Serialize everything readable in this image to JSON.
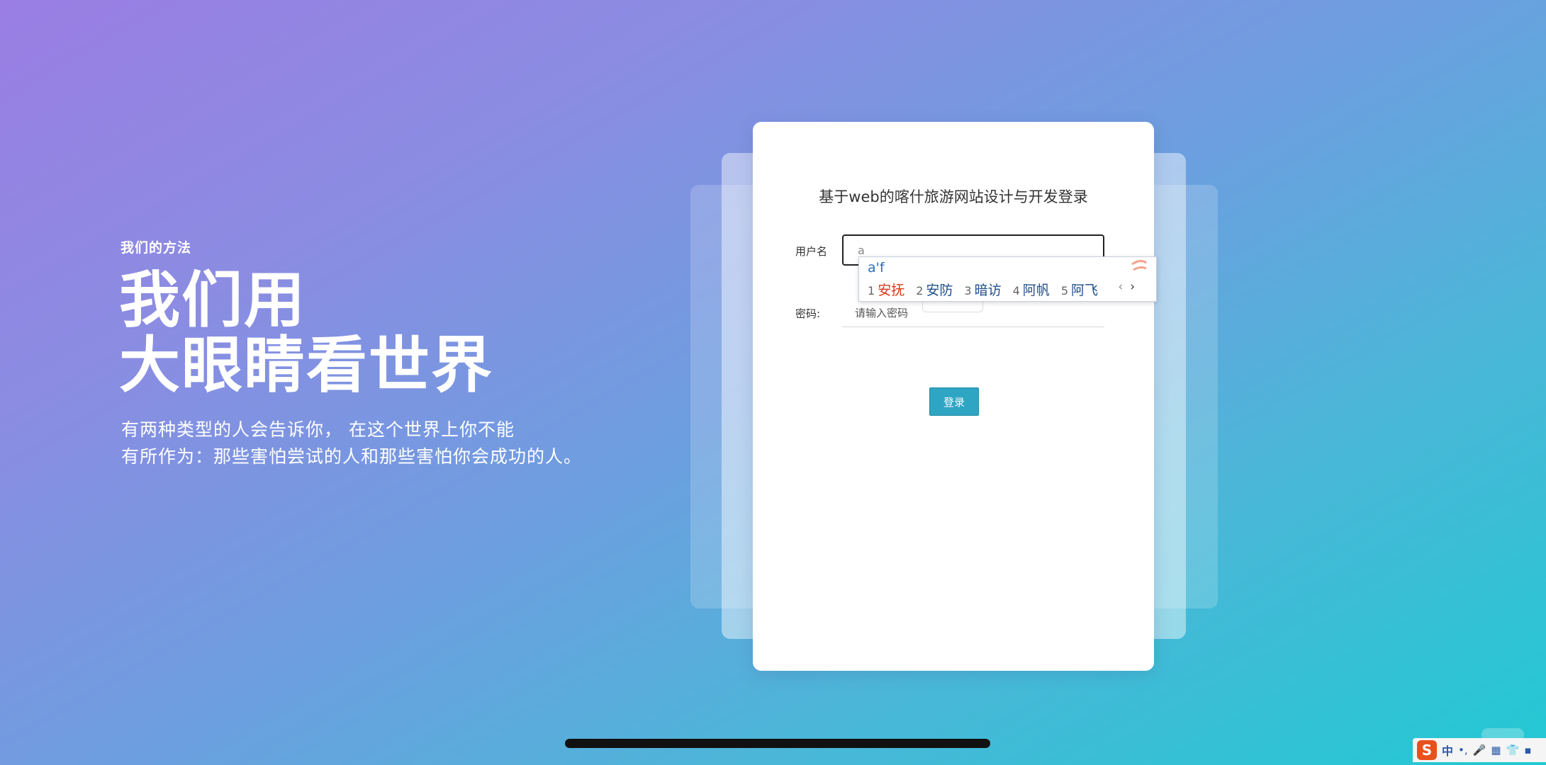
{
  "intro": {
    "kicker": "我们的方法",
    "headline_line1": "我们用",
    "headline_line2": "大眼睛看世界",
    "desc_line1": "有两种类型的人会告诉你， 在这个世界上你不能",
    "desc_line2": "有所作为：那些害怕尝试的人和那些害怕你会成功的人。"
  },
  "login": {
    "title": "基于web的喀什旅游网站设计与开发登录",
    "username_label": "用户名",
    "username_value": "a",
    "password_label": "密码:",
    "password_placeholder": "请输入密码",
    "submit_label": "登录"
  },
  "ime": {
    "composition": "a'f",
    "candidates": [
      {
        "index": "1",
        "text": "安抚"
      },
      {
        "index": "2",
        "text": "安防"
      },
      {
        "index": "3",
        "text": "暗访"
      },
      {
        "index": "4",
        "text": "阿帆"
      },
      {
        "index": "5",
        "text": "阿飞"
      }
    ],
    "prev": "‹",
    "next": "›"
  },
  "taskbar": {
    "ime_logo": "S",
    "lang": "中",
    "punct": "•,",
    "mic": "🎤",
    "keyboard": "▦",
    "skin": "👕",
    "more": "▪"
  },
  "colors": {
    "button": "#2fa5c4",
    "ime_active": "#d9381e",
    "ime_candidate": "#1f4f8a"
  }
}
